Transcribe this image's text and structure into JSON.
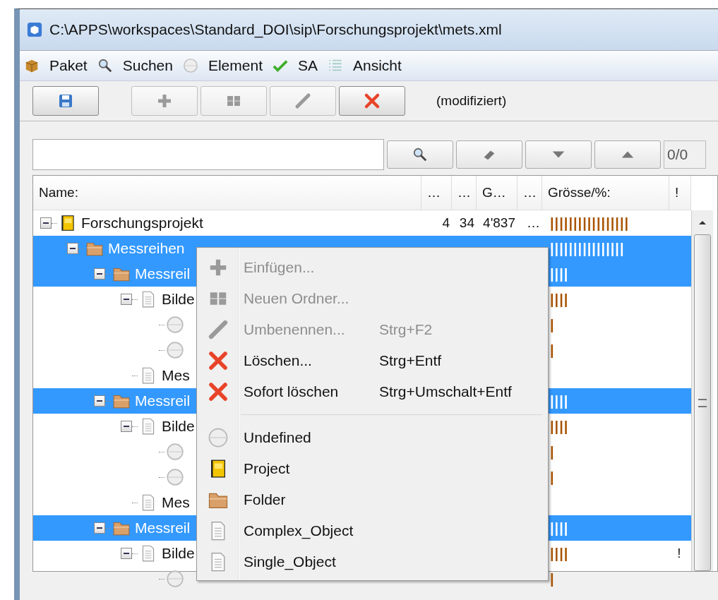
{
  "window": {
    "title": "C:\\APPS\\workspaces\\Standard_DOI\\sip\\Forschungsprojekt\\mets.xml"
  },
  "menu_bar": [
    "Paket",
    "Suchen",
    "Element",
    "SA",
    "Ansicht"
  ],
  "toolbar": {
    "buttons": [
      {
        "disabled": false
      },
      {
        "disabled": true
      },
      {
        "disabled": true
      },
      {
        "disabled": true
      },
      {
        "disabled": false
      }
    ],
    "status": "(modifiziert)"
  },
  "search": {
    "counter": "0/0"
  },
  "table": {
    "columns": [
      "Name:",
      "…",
      "…",
      "G…",
      "…",
      "Grösse/%:",
      "!"
    ],
    "tree": [
      {
        "name": "Forschungsprojekt",
        "kind": "project",
        "selected": false,
        "expanded": true,
        "cells": [
          "4",
          "34",
          "4'837",
          "…"
        ],
        "size_bar": "|||||||||||||||||",
        "children": [
          {
            "name": "Messreihen",
            "kind": "folder",
            "selected": true,
            "expanded": true,
            "size_bar": "||||||||||||||||",
            "children": [
              {
                "name": "Messreil",
                "kind": "folder",
                "selected": true,
                "expanded": true,
                "size_bar": "||||",
                "children": [
                  {
                    "name": "Bilde",
                    "kind": "doc",
                    "selected": false,
                    "expanded": true,
                    "size_bar": "||||",
                    "children": [
                      {
                        "kind": "file",
                        "selected": false,
                        "size_bar": "|"
                      },
                      {
                        "kind": "file",
                        "selected": false,
                        "size_bar": "|"
                      }
                    ]
                  },
                  {
                    "name": "Mes",
                    "kind": "doc",
                    "selected": false
                  }
                ]
              },
              {
                "name": "Messreil",
                "kind": "folder",
                "selected": true,
                "expanded": true,
                "size_bar": "||||",
                "children": [
                  {
                    "name": "Bilde",
                    "kind": "doc",
                    "selected": false,
                    "expanded": true,
                    "size_bar": "||||",
                    "children": [
                      {
                        "kind": "file",
                        "selected": false,
                        "size_bar": "|"
                      },
                      {
                        "kind": "file",
                        "selected": false,
                        "size_bar": "|"
                      }
                    ]
                  },
                  {
                    "name": "Mes",
                    "kind": "doc",
                    "selected": false
                  }
                ]
              },
              {
                "name": "Messreil",
                "kind": "folder",
                "selected": true,
                "expanded": true,
                "size_bar": "||||",
                "children": [
                  {
                    "name": "Bilde",
                    "kind": "doc",
                    "selected": false,
                    "expanded": true,
                    "size_bar": "||||",
                    "flag": "!",
                    "children": [
                      {
                        "kind": "file",
                        "selected": false,
                        "size_bar": "|"
                      }
                    ]
                  }
                ]
              }
            ]
          }
        ]
      }
    ]
  },
  "context_menu": {
    "groups": [
      [
        {
          "label": "Einfügen...",
          "kind": "insert",
          "disabled": true
        },
        {
          "label": "Neuen Ordner...",
          "kind": "new_folder",
          "disabled": true
        },
        {
          "label": "Umbenennen...",
          "kind": "rename",
          "disabled": true,
          "shortcut": "Strg+F2"
        },
        {
          "label": "Löschen...",
          "kind": "delete",
          "disabled": false,
          "shortcut": "Strg+Entf"
        },
        {
          "label": "Sofort löschen",
          "kind": "delete",
          "disabled": false,
          "shortcut": "Strg+Umschalt+Entf"
        }
      ],
      [
        {
          "label": "Undefined",
          "kind": "undefined",
          "disabled": false
        },
        {
          "label": "Project",
          "kind": "project",
          "disabled": false
        },
        {
          "label": "Folder",
          "kind": "folder",
          "disabled": false
        },
        {
          "label": "Complex_Object",
          "kind": "complex_object",
          "disabled": false
        },
        {
          "label": "Single_Object",
          "kind": "single_object",
          "disabled": false
        }
      ]
    ]
  }
}
